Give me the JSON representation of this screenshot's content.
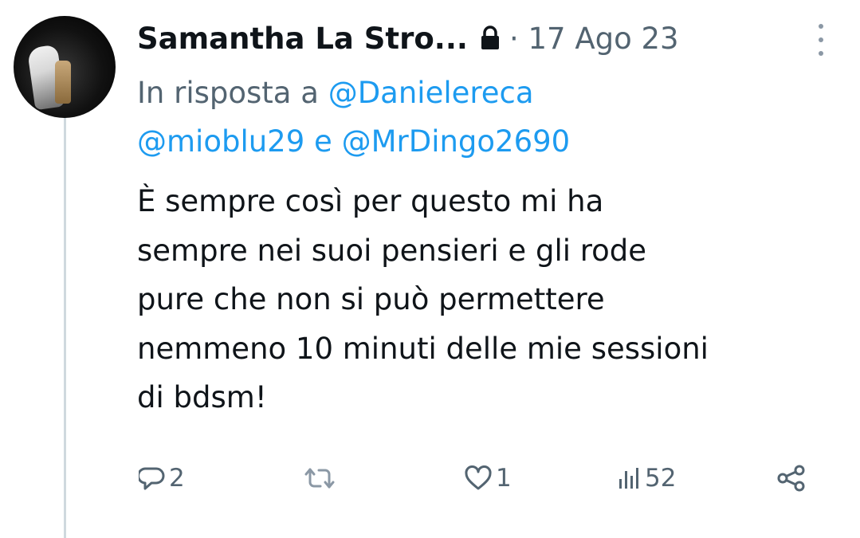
{
  "author": {
    "name": "Samantha La Stro...",
    "date": "· 17 Ago 23"
  },
  "reply": {
    "prefix": "In risposta a",
    "mention1": "@Danielereca",
    "mention2": "@mioblu29",
    "conjunction": "e",
    "mention3": "@MrDingo2690"
  },
  "tweet": {
    "line1": "È sempre così per questo mi ha",
    "line2": "sempre nei suoi pensieri e gli rode",
    "line3": "pure che non si può permettere",
    "line4": "nemmeno 10 minuti delle mie sessioni",
    "line5": "di bdsm!"
  },
  "actions": {
    "replies": "2",
    "retweets": "",
    "likes": "1",
    "views": "52"
  },
  "colors": {
    "text": "#0f1419",
    "muted": "#536471",
    "link": "#1d9bf0",
    "thread_line": "#cfd9de"
  },
  "icons": [
    "lock-icon",
    "more-icon",
    "reply-icon",
    "retweet-icon",
    "like-icon",
    "views-icon",
    "share-icon"
  ]
}
